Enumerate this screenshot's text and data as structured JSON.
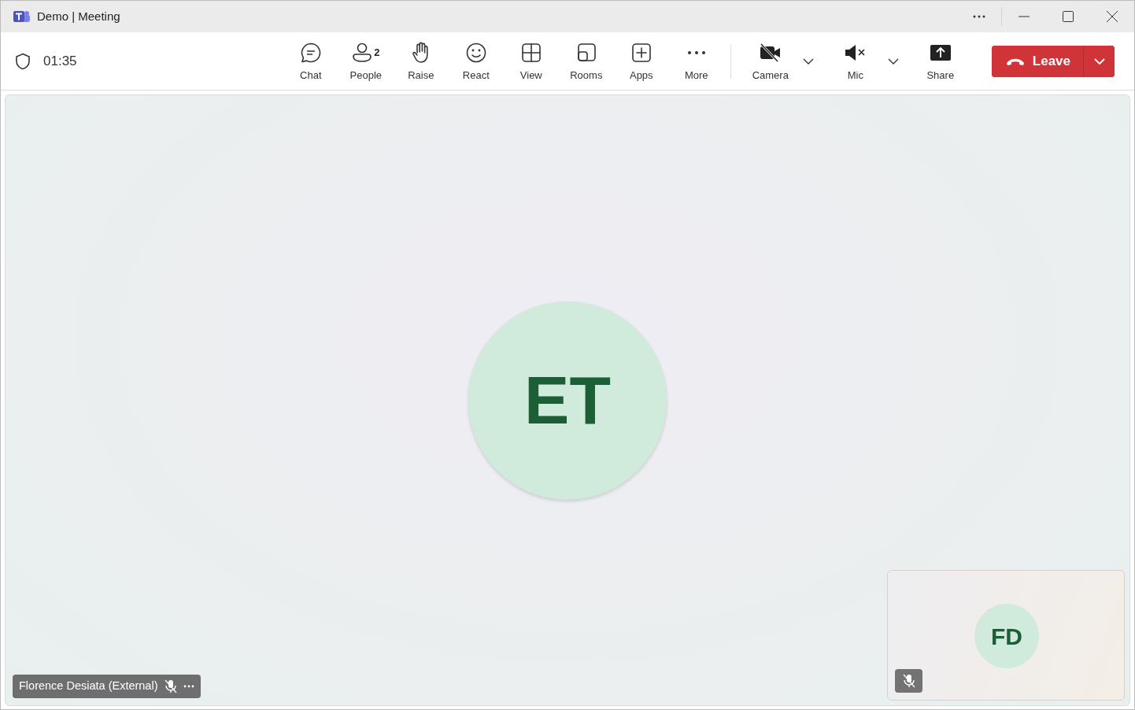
{
  "window": {
    "title": "Demo | Meeting"
  },
  "meeting": {
    "timer": "01:35"
  },
  "toolbar": [
    {
      "kind": "chat",
      "label": "Chat"
    },
    {
      "kind": "people",
      "label": "People",
      "count": "2"
    },
    {
      "kind": "raise",
      "label": "Raise"
    },
    {
      "kind": "react",
      "label": "React"
    },
    {
      "kind": "view",
      "label": "View"
    },
    {
      "kind": "rooms",
      "label": "Rooms"
    },
    {
      "kind": "apps",
      "label": "Apps"
    },
    {
      "kind": "more",
      "label": "More"
    }
  ],
  "devices": [
    {
      "kind": "camera",
      "label": "Camera",
      "on": false
    },
    {
      "kind": "mic",
      "label": "Mic",
      "on": false
    },
    {
      "kind": "share",
      "label": "Share"
    }
  ],
  "leave_button": {
    "label": "Leave"
  },
  "stage": {
    "initials": "ET"
  },
  "name_tag": {
    "name": "Florence Desiata (External)",
    "muted": true
  },
  "self_view": {
    "initials": "FD",
    "muted": true
  }
}
